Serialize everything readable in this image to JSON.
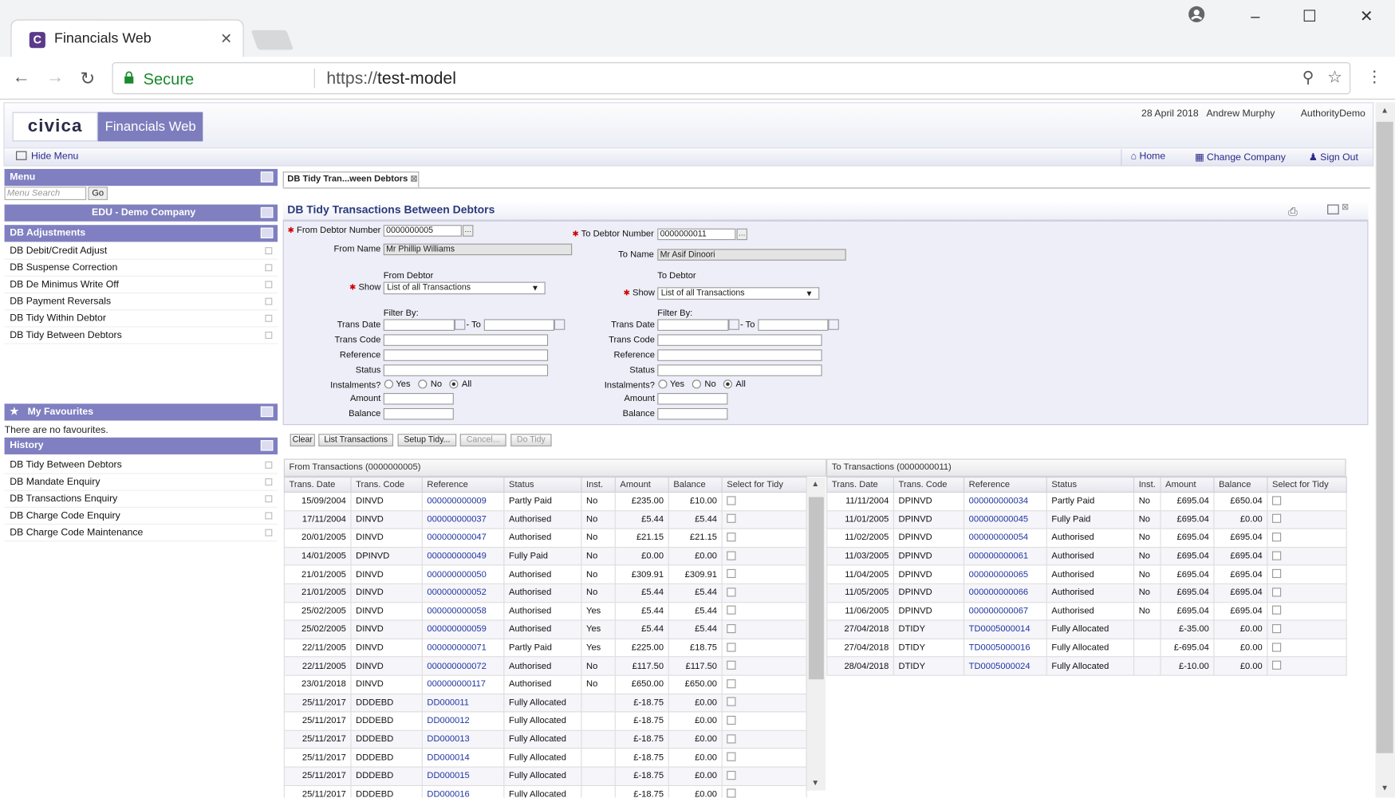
{
  "browser": {
    "tab_title": "Financials Web",
    "tab_icon_letter": "C",
    "secure_label": "Secure",
    "url_scheme": "https://",
    "url_host": "test-model"
  },
  "app": {
    "logo_text": "civica",
    "product_name": "Financials Web",
    "date": "28 April 2018",
    "user": "Andrew Murphy",
    "authority": "AuthorityDemo",
    "hide_menu": "Hide Menu",
    "home": "Home",
    "change_company": "Change Company",
    "sign_out": "Sign Out"
  },
  "sidebar": {
    "menu_title": "Menu",
    "search_placeholder": "Menu Search",
    "go_label": "Go",
    "company": "EDU - Demo Company",
    "section_title": "DB Adjustments",
    "items": [
      "DB Debit/Credit Adjust",
      "DB Suspense Correction",
      "DB De Minimus Write Off",
      "DB Payment Reversals",
      "DB Tidy Within Debtor",
      "DB Tidy Between Debtors"
    ],
    "favourites_title": "My Favourites",
    "favourites_empty": "There are no favourites.",
    "history_title": "History",
    "history": [
      "DB Tidy Between Debtors",
      "DB Mandate Enquiry",
      "DB Transactions Enquiry",
      "DB Charge Code Enquiry",
      "DB Charge Code Maintenance"
    ]
  },
  "form": {
    "tab_label": "DB Tidy Tran...ween Debtors",
    "title": "DB Tidy Transactions Between Debtors",
    "from_debtor_label": "From Debtor Number",
    "from_debtor_value": "0000000005",
    "from_name_label": "From Name",
    "from_name_value": "Mr  Phillip  Williams",
    "to_debtor_label": "To Debtor Number",
    "to_debtor_value": "0000000011",
    "to_name_label": "To Name",
    "to_name_value": "Mr Asif Dinoori",
    "from_debtor_heading": "From Debtor",
    "to_debtor_heading": "To Debtor",
    "show_label": "Show",
    "show_value": "List of all Transactions",
    "filter_by": "Filter By:",
    "trans_date": "Trans Date",
    "to": "- To",
    "trans_code": "Trans Code",
    "reference": "Reference",
    "status": "Status",
    "instalments": "Instalments?",
    "yes": "Yes",
    "no": "No",
    "all": "All",
    "amount": "Amount",
    "balance": "Balance",
    "buttons": {
      "clear": "Clear",
      "list": "List Transactions",
      "setup": "Setup Tidy...",
      "cancel": "Cancel...",
      "do": "Do Tidy"
    }
  },
  "from_grid": {
    "title": "From Transactions (0000000005)",
    "columns": [
      "Trans. Date",
      "Trans. Code",
      "Reference",
      "Status",
      "Inst.",
      "Amount",
      "Balance",
      "Select for Tidy"
    ],
    "rows": [
      [
        "15/09/2004",
        "DINVD",
        "000000000009",
        "Partly Paid",
        "No",
        "£235.00",
        "£10.00"
      ],
      [
        "17/11/2004",
        "DINVD",
        "000000000037",
        "Authorised",
        "No",
        "£5.44",
        "£5.44"
      ],
      [
        "20/01/2005",
        "DINVD",
        "000000000047",
        "Authorised",
        "No",
        "£21.15",
        "£21.15"
      ],
      [
        "14/01/2005",
        "DPINVD",
        "000000000049",
        "Fully Paid",
        "No",
        "£0.00",
        "£0.00"
      ],
      [
        "21/01/2005",
        "DINVD",
        "000000000050",
        "Authorised",
        "No",
        "£309.91",
        "£309.91"
      ],
      [
        "21/01/2005",
        "DINVD",
        "000000000052",
        "Authorised",
        "No",
        "£5.44",
        "£5.44"
      ],
      [
        "25/02/2005",
        "DINVD",
        "000000000058",
        "Authorised",
        "Yes",
        "£5.44",
        "£5.44"
      ],
      [
        "25/02/2005",
        "DINVD",
        "000000000059",
        "Authorised",
        "Yes",
        "£5.44",
        "£5.44"
      ],
      [
        "22/11/2005",
        "DINVD",
        "000000000071",
        "Partly Paid",
        "Yes",
        "£225.00",
        "£18.75"
      ],
      [
        "22/11/2005",
        "DINVD",
        "000000000072",
        "Authorised",
        "No",
        "£117.50",
        "£117.50"
      ],
      [
        "23/01/2018",
        "DINVD",
        "000000000117",
        "Authorised",
        "No",
        "£650.00",
        "£650.00"
      ],
      [
        "25/11/2017",
        "DDDEBD",
        "DD000011",
        "Fully Allocated",
        "",
        "£-18.75",
        "£0.00"
      ],
      [
        "25/11/2017",
        "DDDEBD",
        "DD000012",
        "Fully Allocated",
        "",
        "£-18.75",
        "£0.00"
      ],
      [
        "25/11/2017",
        "DDDEBD",
        "DD000013",
        "Fully Allocated",
        "",
        "£-18.75",
        "£0.00"
      ],
      [
        "25/11/2017",
        "DDDEBD",
        "DD000014",
        "Fully Allocated",
        "",
        "£-18.75",
        "£0.00"
      ],
      [
        "25/11/2017",
        "DDDEBD",
        "DD000015",
        "Fully Allocated",
        "",
        "£-18.75",
        "£0.00"
      ],
      [
        "25/11/2017",
        "DDDEBD",
        "DD000016",
        "Fully Allocated",
        "",
        "£-18.75",
        "£0.00"
      ]
    ]
  },
  "to_grid": {
    "title": "To Transactions (0000000011)",
    "columns": [
      "Trans. Date",
      "Trans. Code",
      "Reference",
      "Status",
      "Inst.",
      "Amount",
      "Balance",
      "Select for Tidy"
    ],
    "rows": [
      [
        "11/11/2004",
        "DPINVD",
        "000000000034",
        "Partly Paid",
        "No",
        "£695.04",
        "£650.04"
      ],
      [
        "11/01/2005",
        "DPINVD",
        "000000000045",
        "Fully Paid",
        "No",
        "£695.04",
        "£0.00"
      ],
      [
        "11/02/2005",
        "DPINVD",
        "000000000054",
        "Authorised",
        "No",
        "£695.04",
        "£695.04"
      ],
      [
        "11/03/2005",
        "DPINVD",
        "000000000061",
        "Authorised",
        "No",
        "£695.04",
        "£695.04"
      ],
      [
        "11/04/2005",
        "DPINVD",
        "000000000065",
        "Authorised",
        "No",
        "£695.04",
        "£695.04"
      ],
      [
        "11/05/2005",
        "DPINVD",
        "000000000066",
        "Authorised",
        "No",
        "£695.04",
        "£695.04"
      ],
      [
        "11/06/2005",
        "DPINVD",
        "000000000067",
        "Authorised",
        "No",
        "£695.04",
        "£695.04"
      ],
      [
        "27/04/2018",
        "DTIDY",
        "TD0005000014",
        "Fully Allocated",
        "",
        "£-35.00",
        "£0.00"
      ],
      [
        "27/04/2018",
        "DTIDY",
        "TD0005000016",
        "Fully Allocated",
        "",
        "£-695.04",
        "£0.00"
      ],
      [
        "28/04/2018",
        "DTIDY",
        "TD0005000024",
        "Fully Allocated",
        "",
        "£-10.00",
        "£0.00"
      ]
    ]
  }
}
